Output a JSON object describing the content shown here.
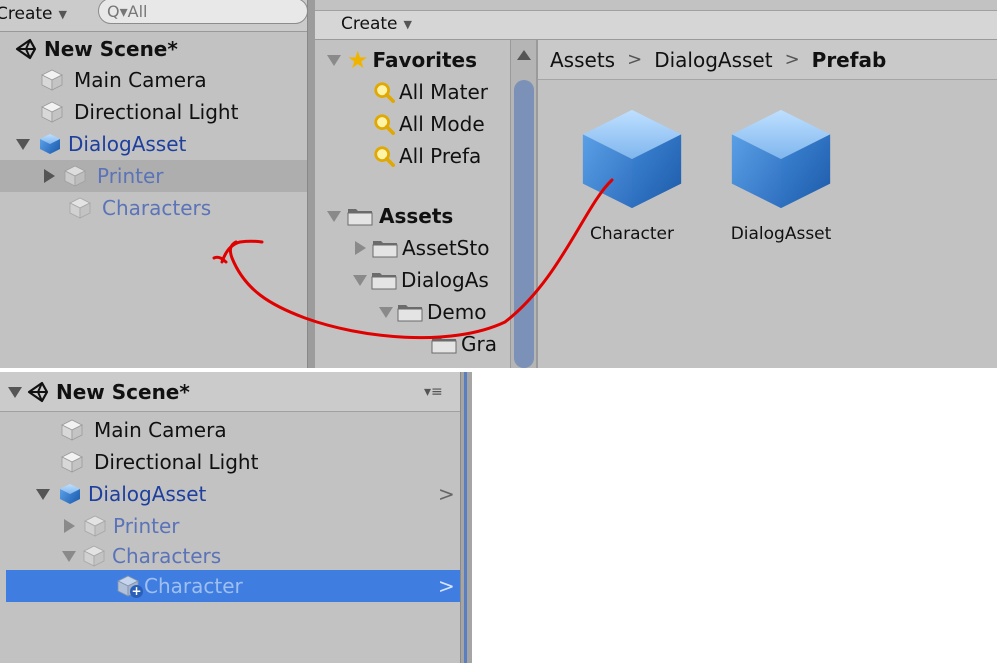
{
  "top_hierarchy": {
    "create_label": "Create",
    "search_placeholder": "Q▾All",
    "scene_name": "New Scene*",
    "items": [
      "Main Camera",
      "Directional Light",
      "DialogAsset",
      "Printer",
      "Characters"
    ]
  },
  "project": {
    "create_label": "Create",
    "favorites": {
      "label": "Favorites",
      "items": [
        "All Mater",
        "All Mode",
        "All Prefa"
      ]
    },
    "assets": {
      "label": "Assets",
      "items": [
        "AssetSto",
        "DialogAs",
        "Demo",
        "Gra"
      ]
    },
    "breadcrumb": [
      "Assets",
      "DialogAsset",
      "Prefab"
    ],
    "prefabs": [
      "Character",
      "DialogAsset"
    ]
  },
  "bottom_hierarchy": {
    "scene_name": "New Scene*",
    "items": [
      "Main Camera",
      "Directional Light",
      "DialogAsset",
      "Printer",
      "Characters",
      "Character"
    ]
  },
  "colors": {
    "panel_bg": "#c2c2c2",
    "selection": "#3f7ee0",
    "prefab_text": "#1e3f9e",
    "annotation": "#e00000"
  },
  "icons": [
    "unity-scene-icon",
    "gameobject-cube-icon",
    "prefab-cube-icon",
    "favorites-star-icon",
    "search-magnifier-icon",
    "folder-icon",
    "menu-icon"
  ]
}
